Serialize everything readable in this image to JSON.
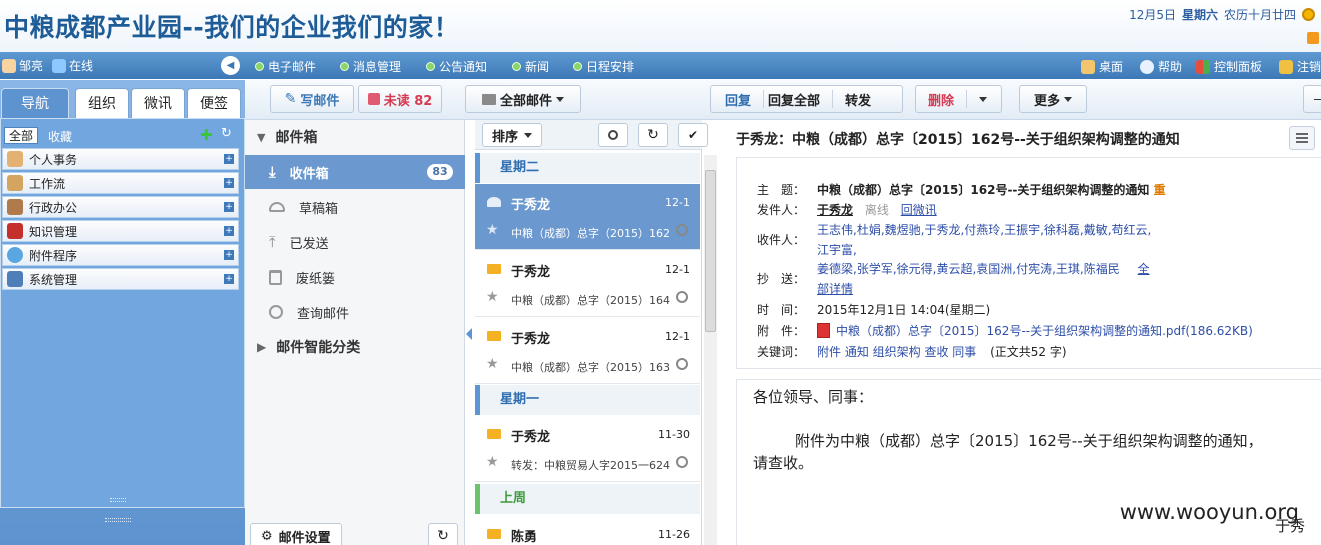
{
  "header": {
    "title": "中粮成都产业园--我们的企业我们的家！",
    "date": "12月5日",
    "weekday": "星期六",
    "lunar": "农历十月廿四"
  },
  "navbar": {
    "user": "邹亮",
    "status": "在线",
    "items": [
      "电子邮件",
      "消息管理",
      "公告通知",
      "新闻",
      "日程安排"
    ],
    "right": [
      "桌面",
      "帮助",
      "控制面板",
      "注销"
    ]
  },
  "leftnav": {
    "tabs": [
      "导航",
      "组织",
      "微讯",
      "便签"
    ],
    "filter_all": "全部",
    "filter_fav": "收藏",
    "items": [
      "个人事务",
      "工作流",
      "行政办公",
      "知识管理",
      "附件程序",
      "系统管理"
    ]
  },
  "toolbar": {
    "compose": "写邮件",
    "unread": "未读 82",
    "all_mail": "全部邮件",
    "reply": "回复",
    "reply_all": "回复全部",
    "forward": "转发",
    "delete": "删除",
    "more": "更多"
  },
  "folders": {
    "section_mailbox": "邮件箱",
    "inbox": "收件箱",
    "inbox_count": "83",
    "drafts": "草稿箱",
    "sent": "已发送",
    "trash": "废纸篓",
    "search": "查询邮件",
    "section_smart": "邮件智能分类",
    "settings": "邮件设置"
  },
  "list": {
    "sort": "排序",
    "groups": [
      "星期二",
      "星期一",
      "上周"
    ],
    "items": [
      {
        "from": "于秀龙",
        "date": "12-1",
        "subject": "中粮（成都）总字（2015）162"
      },
      {
        "from": "于秀龙",
        "date": "12-1",
        "subject": "中粮（成都）总字（2015）164"
      },
      {
        "from": "于秀龙",
        "date": "12-1",
        "subject": "中粮（成都）总字（2015）163"
      },
      {
        "from": "于秀龙",
        "date": "11-30",
        "subject": "转发：中粮贸易人字2015一624"
      },
      {
        "from": "陈勇",
        "date": "11-26",
        "subject": ""
      }
    ]
  },
  "reader": {
    "title": "于秀龙：中粮（成都）总字〔2015〕162号--关于组织架构调整的通知",
    "labels": {
      "subject": "主　题：",
      "sender": "发件人：",
      "recipients": "收件人：",
      "cc": "抄　送：",
      "time": "时　间：",
      "attachment": "附　件：",
      "keywords": "关键词："
    },
    "subject": "中粮（成都）总字〔2015〕162号--关于组织架构调整的通知",
    "subject_tag": "重",
    "sender": "于秀龙",
    "sender_status": "离线",
    "reply_inline": "回微讯",
    "recipients_line1": "王志伟,杜娟,魏煜驰,于秀龙,付燕玲,王振宇,徐科磊,戴敏,苟红云,",
    "recipients_line2": "江宇富,",
    "cc_line1": "姜德梁,张学军,徐元得,黄云超,袁国洲,付宪涛,王琪,陈福民",
    "cc_all": "全",
    "cc_line2": "部详情",
    "time": "2015年12月1日 14:04(星期二)",
    "attachment": "中粮（成都）总字〔2015〕162号--关于组织架构调整的通知.pdf(186.62KB)",
    "keywords": "附件 通知 组织架构 查收 同事",
    "wordcount": "(正文共52 字)",
    "greeting": "各位领导、同事：",
    "body_line1": "附件为中粮（成都）总字〔2015〕162号--关于组织架构调整的通知，",
    "body_line2": "请查收。",
    "signature": "于秀"
  },
  "watermark": "www.wooyun.org"
}
